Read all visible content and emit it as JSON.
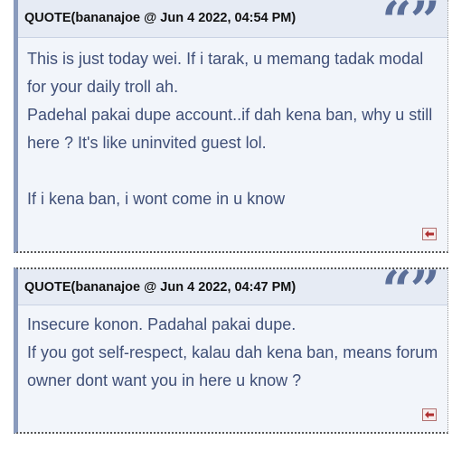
{
  "quotes": [
    {
      "title": "QUOTE(bananajoe @ Jun 4 2022, 04:54 PM)",
      "quote_mark": "“”",
      "paragraphs": [
        "This is just today wei. If i tarak, u memang tadak modal for your daily troll ah.",
        "Padehal pakai dupe account..if dah kena ban, why u still here ? It's like uninvited guest lol.",
        "If i kena ban, i wont come in u know"
      ],
      "back_icon": "arrow-left-icon"
    },
    {
      "title": "QUOTE(bananajoe @ Jun 4 2022, 04:47 PM)",
      "quote_mark": "“”",
      "paragraphs": [
        "Insecure konon. Padahal pakai dupe.",
        "If you got self-respect, kalau dah kena ban, means forum owner dont want you in here u know ?"
      ],
      "back_icon": "arrow-left-icon"
    }
  ],
  "colors": {
    "quote_text": "#3f4f77",
    "quote_mark": "#5b6f99",
    "header_bg": "#e6ebf4",
    "body_bg": "#f2f5fa",
    "accent_border": "#8a9bbd",
    "back_icon": "#b03030"
  }
}
